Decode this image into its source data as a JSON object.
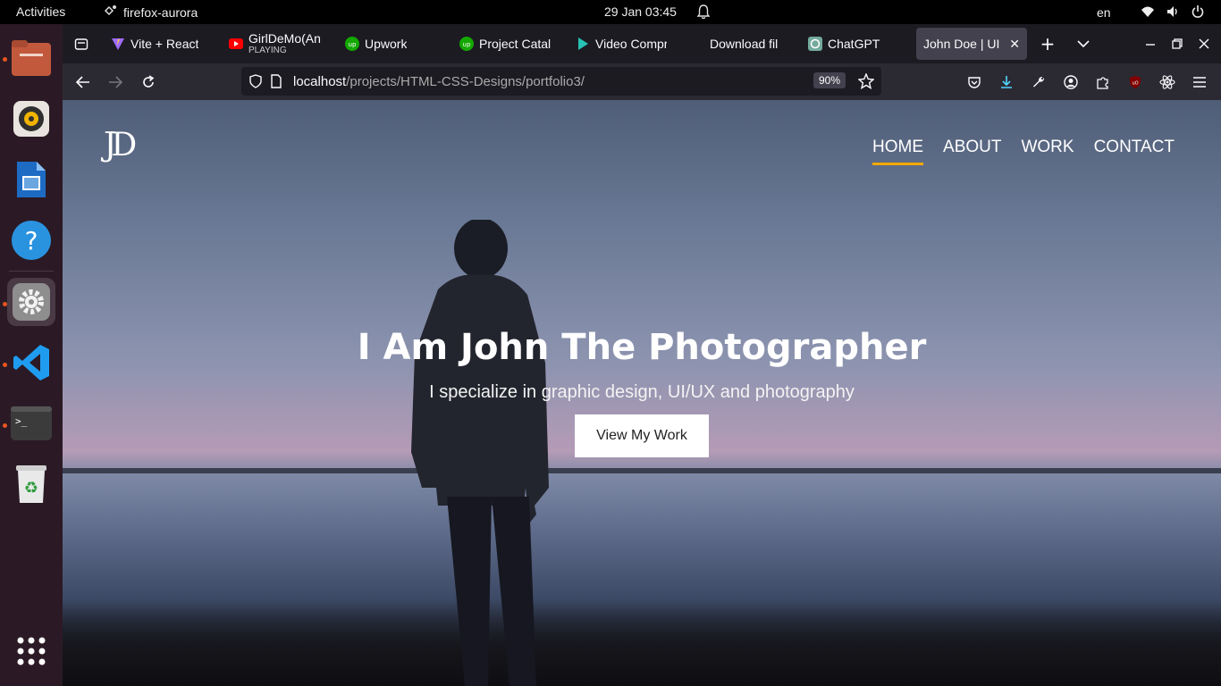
{
  "system_bar": {
    "activities": "Activities",
    "app_name": "firefox-aurora",
    "clock": "29 Jan  03:45",
    "language": "en"
  },
  "dock": {
    "items": [
      "files-icon",
      "rhythmbox-icon",
      "writer-icon",
      "help-icon",
      "settings-icon",
      "vscode-icon",
      "terminal-icon",
      "trash-icon",
      "app-grid-icon"
    ]
  },
  "browser": {
    "tabs": [
      {
        "label": "Vite + React",
        "icon": "vite-icon"
      },
      {
        "label": "GirlDeMo(An",
        "sub": "PLAYING",
        "icon": "youtube-icon"
      },
      {
        "label": "Upwork",
        "icon": "upwork-icon"
      },
      {
        "label": "Project Catal",
        "icon": "upwork-icon"
      },
      {
        "label": "Video Compr",
        "icon": "play-icon"
      },
      {
        "label": "Download fil",
        "icon": "none"
      },
      {
        "label": "ChatGPT",
        "icon": "chatgpt-icon"
      },
      {
        "label": "John Doe | UI",
        "icon": "none",
        "active": true
      }
    ],
    "url_host": "localhost",
    "url_path": "/projects/HTML-CSS-Designs/portfolio3/",
    "zoom": "90%"
  },
  "page": {
    "logo": "JD",
    "nav": [
      "HOME",
      "ABOUT",
      "WORK",
      "CONTACT"
    ],
    "active_nav": "HOME",
    "hero_title": "I Am John The Photographer",
    "hero_subtitle": "I specialize in graphic design, UI/UX and photography",
    "cta_label": "View My Work",
    "accent_color": "#f2a900"
  }
}
